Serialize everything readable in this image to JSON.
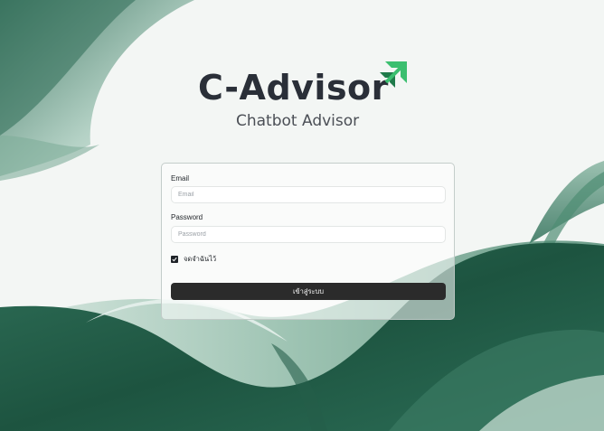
{
  "brand": {
    "name": "C-Advisor",
    "tagline": "Chatbot Advisor",
    "accent_color": "#3bbf6f",
    "logo_icon": "double-arrow-up-right-icon"
  },
  "login_form": {
    "email_label": "Email",
    "email_placeholder": "Email",
    "email_value": "",
    "password_label": "Password",
    "password_placeholder": "Password",
    "password_value": "",
    "remember_label": "จดจำฉันไว้",
    "remember_checked": true,
    "submit_label": "เข้าสู่ระบบ"
  },
  "theme": {
    "background": "#f3f6f4",
    "wave_dark": "#1e5a45",
    "wave_mid": "#4a8b72",
    "wave_light": "#b9d6c9",
    "button_color": "#2b2b2b"
  }
}
